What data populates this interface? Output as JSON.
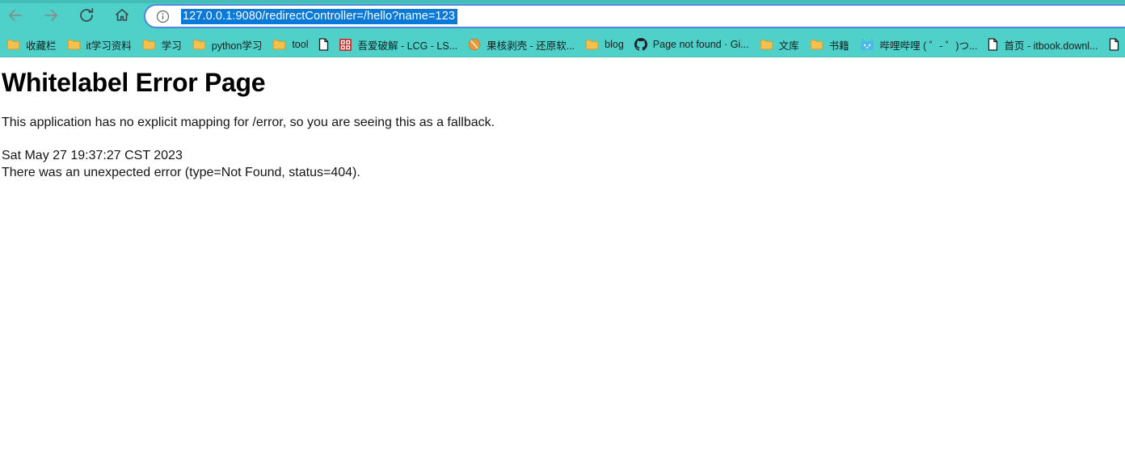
{
  "colors": {
    "toolbar_teal": "#4fd0c8",
    "focus_ring_blue": "#4f86df",
    "url_selection_blue": "#0a79d8",
    "folder_yellow": "#f5c14e"
  },
  "toolbar": {
    "address": {
      "url": "127.0.0.1:9080/redirectController=/hello?name=123",
      "selected": true
    }
  },
  "bookmarks": [
    {
      "icon": "folder-icon",
      "label": "收藏栏"
    },
    {
      "icon": "folder-icon",
      "label": "it学习资料"
    },
    {
      "icon": "folder-icon",
      "label": "学习"
    },
    {
      "icon": "folder-icon",
      "label": "python学习"
    },
    {
      "icon": "folder-icon",
      "label": "tool"
    },
    {
      "icon": "page-icon",
      "label": ""
    },
    {
      "icon": "red-seal-icon",
      "label": "吾爱破解 - LCG - LS..."
    },
    {
      "icon": "orange-ball-icon",
      "label": "果核剥壳 - 还原软..."
    },
    {
      "icon": "folder-icon",
      "label": "blog"
    },
    {
      "icon": "github-icon",
      "label": "Page not found · Gi..."
    },
    {
      "icon": "folder-icon",
      "label": "文库"
    },
    {
      "icon": "folder-icon",
      "label": "书籍"
    },
    {
      "icon": "bilibili-icon",
      "label": "哔哩哔哩 ( ゜- ゜)つ..."
    },
    {
      "icon": "page-icon",
      "label": "首页 - itbook.downl..."
    },
    {
      "icon": "page-icon",
      "label": ""
    }
  ],
  "content": {
    "title": "Whitelabel Error Page",
    "message": "This application has no explicit mapping for /error, so you are seeing this as a fallback.",
    "timestamp": "Sat May 27 19:37:27 CST 2023",
    "error_line": "There was an unexpected error (type=Not Found, status=404)."
  }
}
